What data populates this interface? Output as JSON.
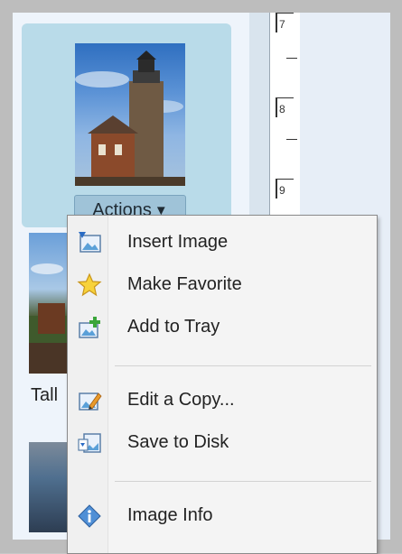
{
  "thumbnail": {
    "actions_label": "Actions",
    "caret": "▼"
  },
  "second_thumbnail": {
    "caption": "Tall"
  },
  "ruler": {
    "labels": [
      "7",
      "8",
      "9"
    ]
  },
  "menu": {
    "items": [
      {
        "label": "Insert Image",
        "icon": "insert-image-icon"
      },
      {
        "label": "Make Favorite",
        "icon": "star-icon"
      },
      {
        "label": "Add to Tray",
        "icon": "add-to-tray-icon"
      },
      {
        "label": "Edit a Copy...",
        "icon": "edit-copy-icon"
      },
      {
        "label": "Save to Disk",
        "icon": "save-to-disk-icon"
      },
      {
        "label": "Image Info",
        "icon": "info-icon"
      }
    ]
  },
  "colors": {
    "selected_card": "#b9dbe9",
    "actions_button": "#9fc3d8",
    "menu_background": "#f4f4f4"
  }
}
